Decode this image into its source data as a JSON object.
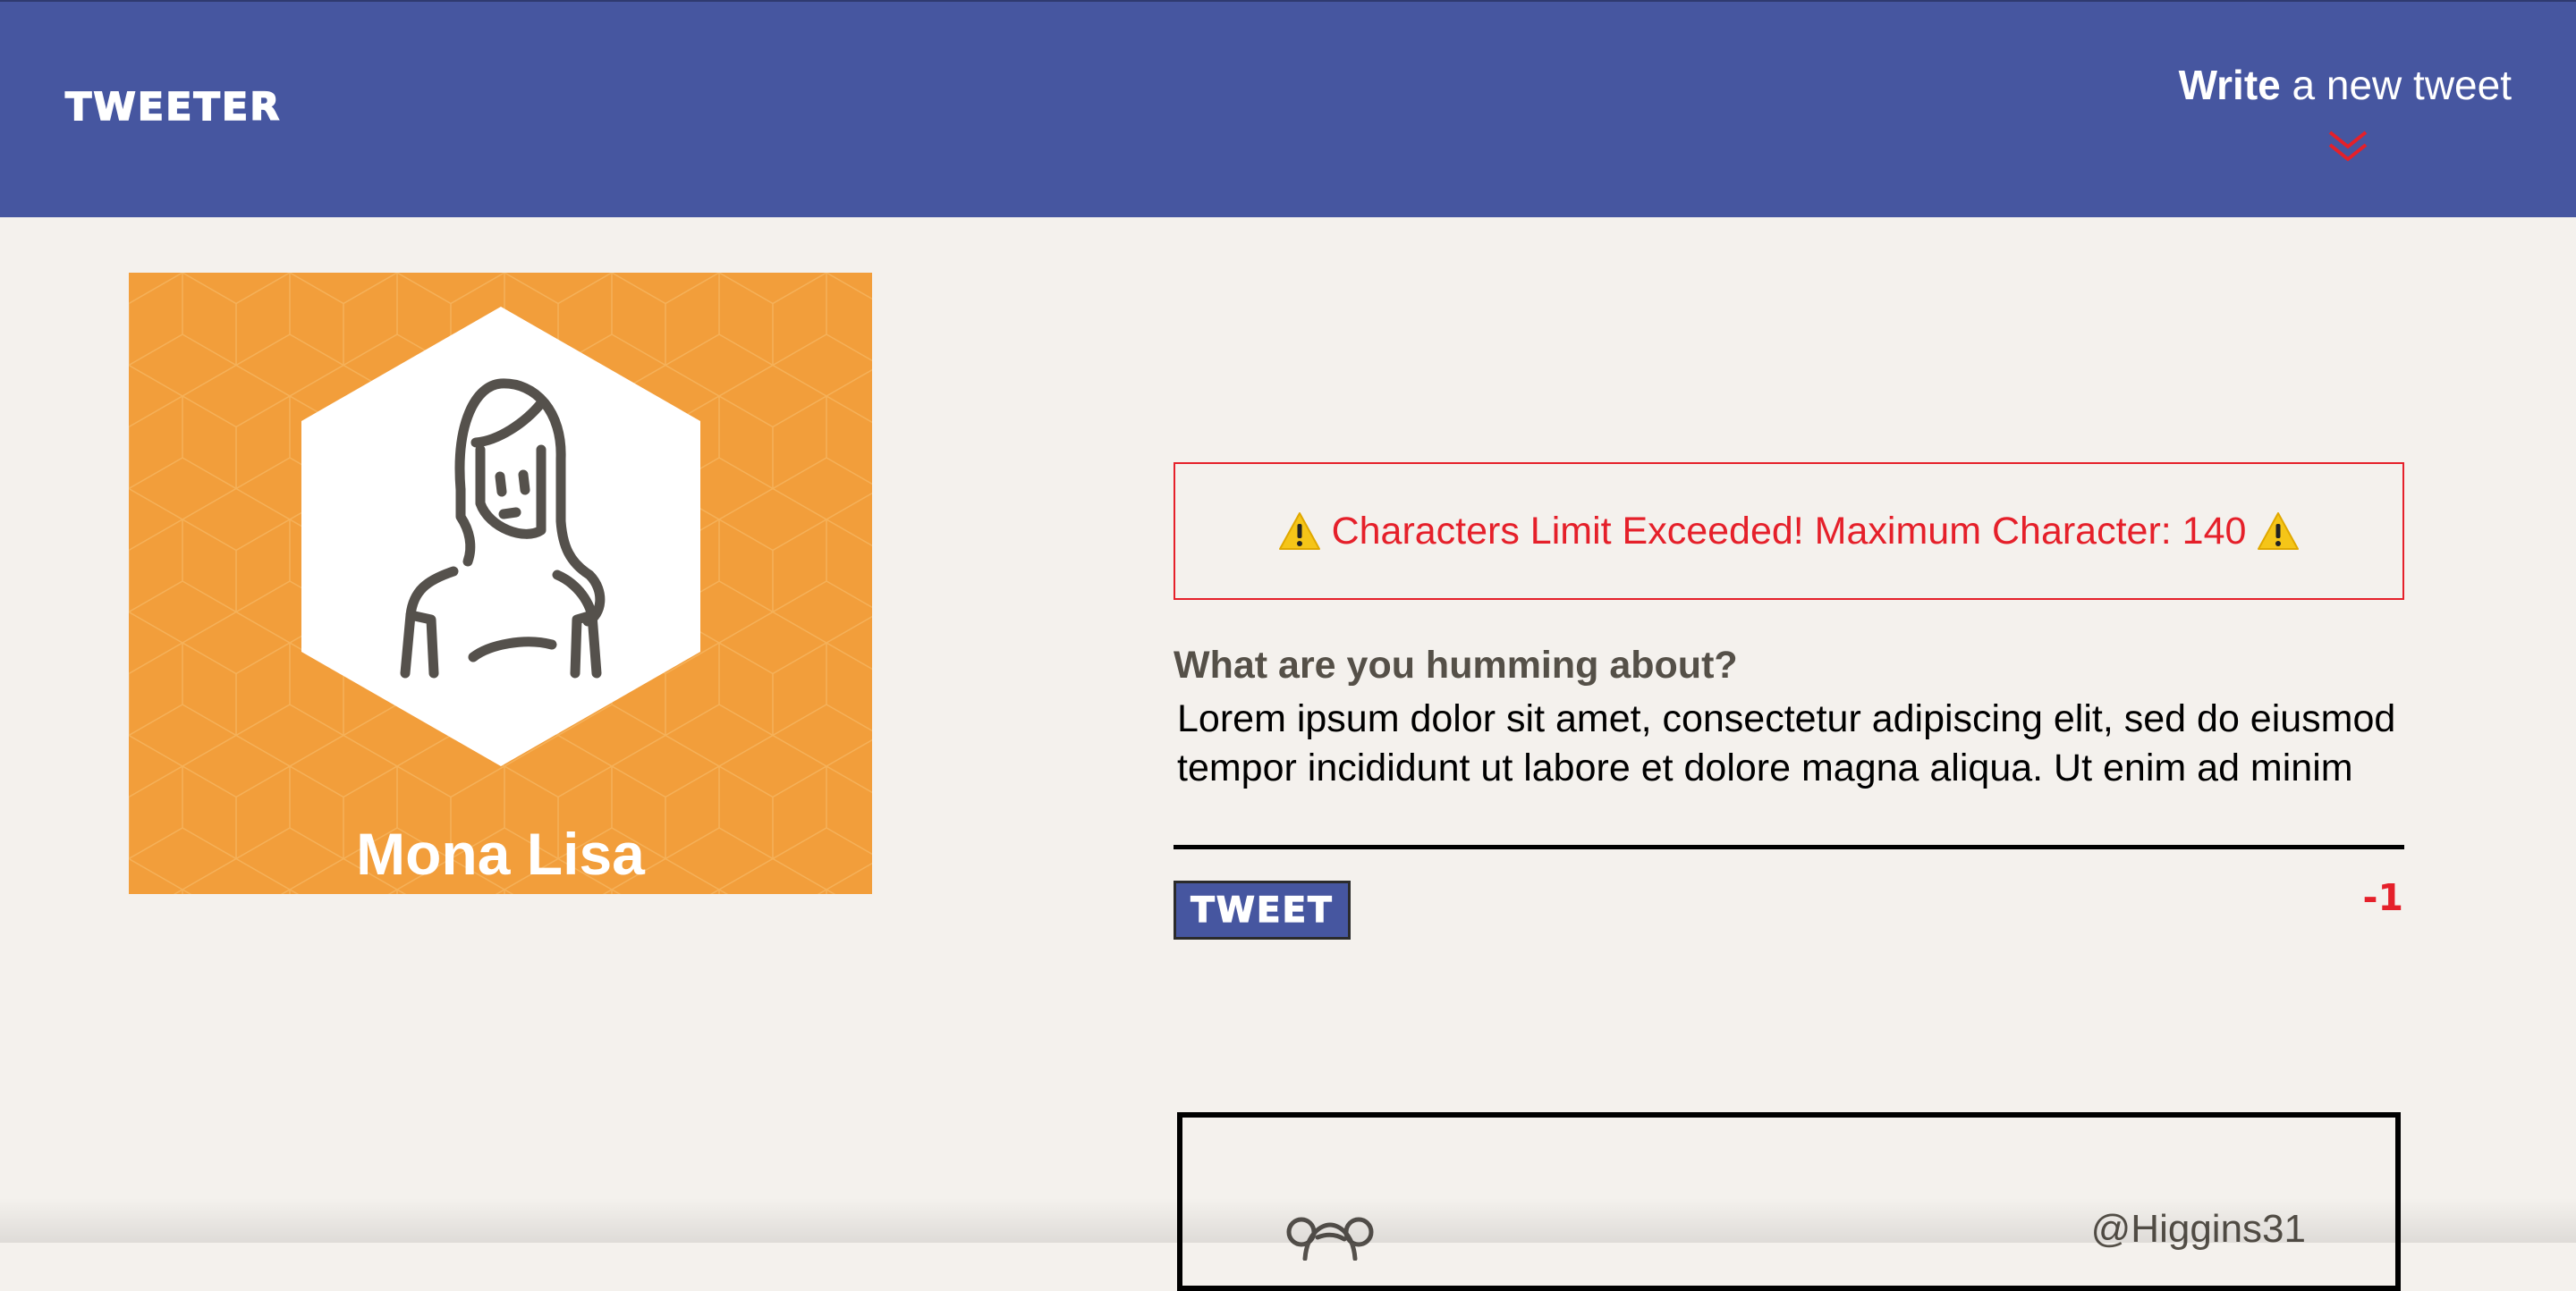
{
  "nav": {
    "brand": "TWEETER",
    "compose_bold": "Write",
    "compose_rest": " a new tweet",
    "chevron_icon": "double-chevron-down-icon",
    "colors": {
      "background": "#4656a0",
      "chevron": "#e5202a"
    }
  },
  "profile": {
    "name": "Mona Lisa",
    "avatar_icon": "woman-avatar-icon",
    "background_color": "#f29e3b"
  },
  "alert": {
    "icon": "warning-icon",
    "message": "Characters Limit Exceeded! Maximum Character: 140",
    "color": "#e5202a"
  },
  "composer": {
    "prompt": "What are you humming about?",
    "text": "Lorem ipsum dolor sit amet, consectetur adipiscing elit, sed do eiusmod tempor incididunt ut labore et dolore magna aliqua. Ut enim ad minim",
    "button_label": "TWEET",
    "remaining": "-1"
  },
  "feed": {
    "items": [
      {
        "handle": "@Higgins31",
        "avatar_icon": "girl-avatar-icon"
      }
    ]
  }
}
